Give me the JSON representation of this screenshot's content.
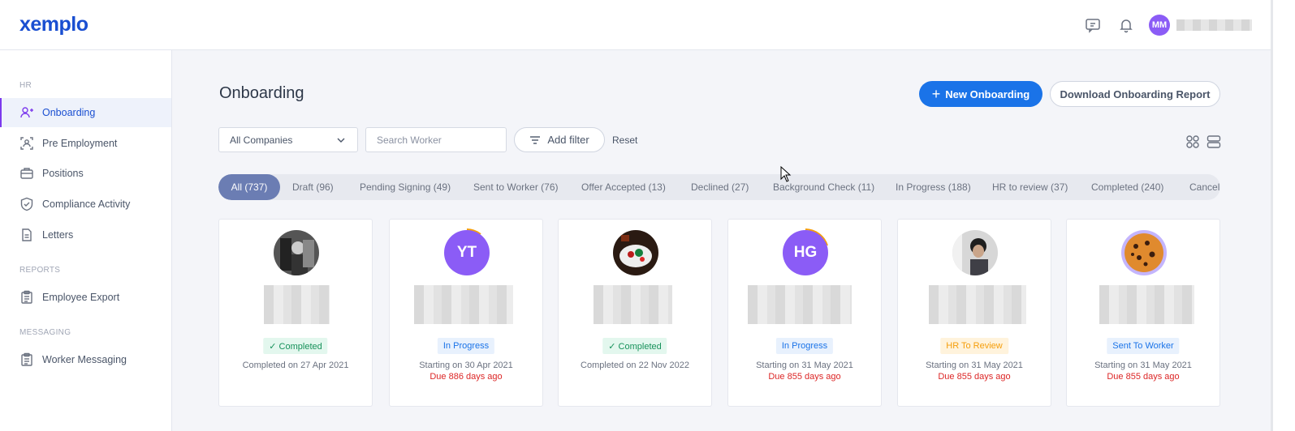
{
  "brand": {
    "logo": "xemplo",
    "accent": "#1a73e8",
    "purple": "#8b5cf6"
  },
  "header": {
    "icons": [
      "chat-icon",
      "bell-icon"
    ],
    "user": {
      "initials": "MM"
    }
  },
  "sidebar": {
    "sections": [
      {
        "label": "HR",
        "items": [
          {
            "label": "Onboarding",
            "icon": "user-plus-icon",
            "active": true
          },
          {
            "label": "Pre Employment",
            "icon": "user-scan-icon"
          },
          {
            "label": "Positions",
            "icon": "briefcase-icon"
          },
          {
            "label": "Compliance Activity",
            "icon": "shield-check-icon"
          },
          {
            "label": "Letters",
            "icon": "document-icon"
          }
        ]
      },
      {
        "label": "REPORTS",
        "items": [
          {
            "label": "Employee Export",
            "icon": "clipboard-icon"
          }
        ]
      },
      {
        "label": "MESSAGING",
        "items": [
          {
            "label": "Worker Messaging",
            "icon": "clipboard-icon"
          }
        ]
      }
    ]
  },
  "main": {
    "title": "Onboarding",
    "new_button": "New Onboarding",
    "download_button": "Download Onboarding Report",
    "company_select": "All Companies",
    "search_placeholder": "Search Worker",
    "add_filter": "Add filter",
    "reset": "Reset",
    "tabs": [
      {
        "label": "All (737)",
        "active": true
      },
      {
        "label": "Draft (96)"
      },
      {
        "label": "Pending Signing (49)"
      },
      {
        "label": "Sent to Worker (76)"
      },
      {
        "label": "Offer Accepted (13)"
      },
      {
        "label": "Declined (27)"
      },
      {
        "label": "Background Check (11)"
      },
      {
        "label": "In Progress (188)"
      },
      {
        "label": "HR to review (37)"
      },
      {
        "label": "Completed (240)"
      },
      {
        "label": "Cancell"
      }
    ],
    "cards": [
      {
        "avatar": "photo-bw",
        "status": "✓ Completed",
        "status_type": "completed",
        "line1": "Completed on 27 Apr 2021",
        "line2": ""
      },
      {
        "avatar": "initials",
        "initials": "YT",
        "status": "In Progress",
        "status_type": "progress",
        "line1": "Starting on 30 Apr 2021",
        "line2": "Due 886 days ago"
      },
      {
        "avatar": "photo-food",
        "status": "✓ Completed",
        "status_type": "completed",
        "line1": "Completed on 22 Nov 2022",
        "line2": ""
      },
      {
        "avatar": "initials",
        "initials": "HG",
        "status": "In Progress",
        "status_type": "progress",
        "line1": "Starting on 31 May 2021",
        "line2": "Due 855 days ago"
      },
      {
        "avatar": "photo-person",
        "status": "HR To Review",
        "status_type": "review",
        "line1": "Starting on 31 May 2021",
        "line2": "Due 855 days ago"
      },
      {
        "avatar": "photo-cookie",
        "status": "Sent To Worker",
        "status_type": "sent",
        "line1": "Starting on 31 May 2021",
        "line2": "Due 855 days ago"
      }
    ]
  }
}
